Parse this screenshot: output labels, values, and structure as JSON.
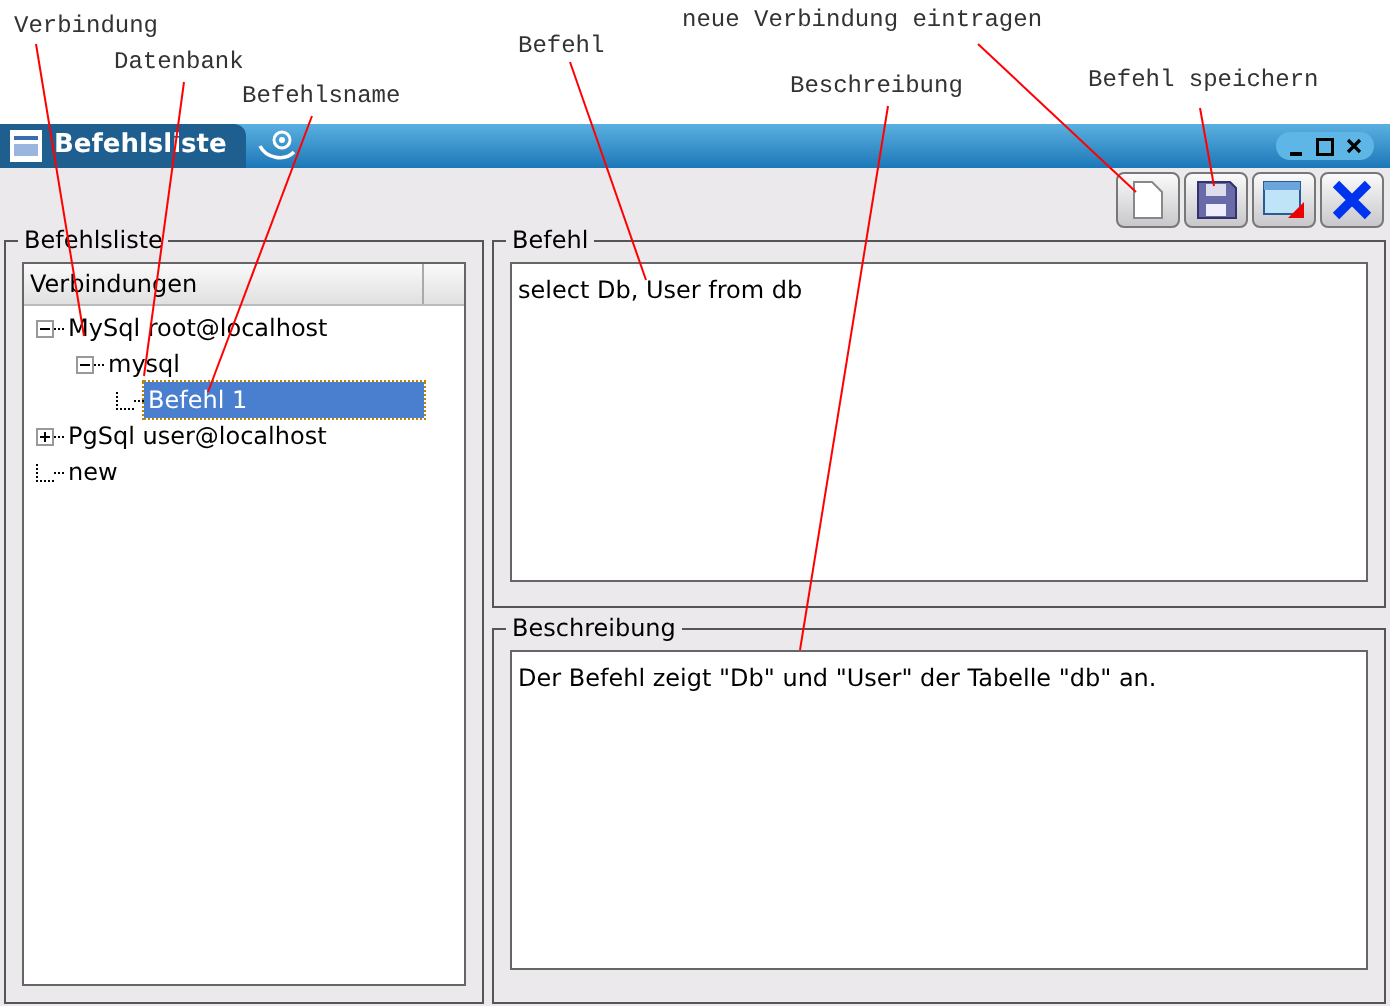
{
  "annotations": [
    "Verbindung",
    "Datenbank",
    "Befehlsname",
    "Befehl",
    "neue Verbindung eintragen",
    "Beschreibung",
    "Befehl speichern"
  ],
  "window": {
    "title": "Befehlsliste"
  },
  "toolbar": [
    {
      "kind": "new"
    },
    {
      "kind": "save"
    },
    {
      "kind": "window"
    },
    {
      "kind": "close"
    }
  ],
  "list_panel": {
    "title": "Befehlsliste",
    "column": "Verbindungen",
    "tree": [
      {
        "label": "MySql root@localhost",
        "expanded": true,
        "selected": false,
        "children": [
          {
            "label": "mysql",
            "expanded": true,
            "selected": false,
            "children": [
              {
                "label": "Befehl 1",
                "selected": true
              }
            ]
          }
        ]
      },
      {
        "label": "PgSql user@localhost",
        "expanded": false,
        "selected": false
      },
      {
        "label": "new",
        "selected": false
      }
    ]
  },
  "command_panel": {
    "title": "Befehl",
    "value": "select Db, User from db"
  },
  "description_panel": {
    "title": "Beschreibung",
    "value": "Der Befehl zeigt \"Db\" und \"User\" der Tabelle \"db\" an."
  }
}
